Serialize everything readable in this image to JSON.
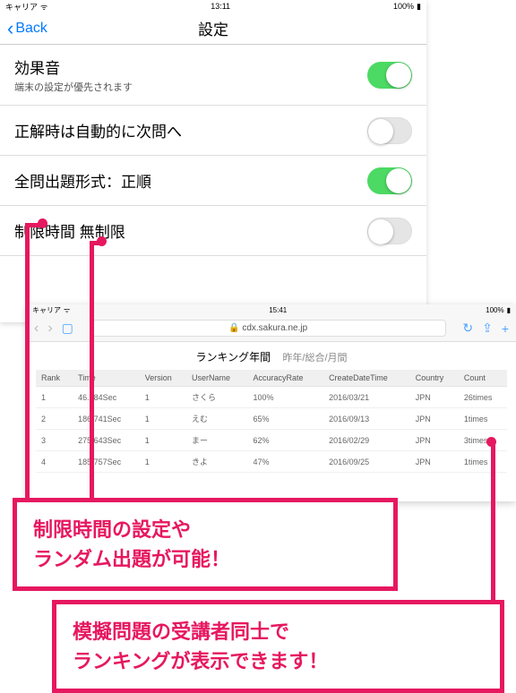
{
  "settings": {
    "status": {
      "carrier": "キャリア",
      "wifi": "ᯤ",
      "time": "13:11",
      "battery": "100%"
    },
    "back": "Back",
    "title": "設定",
    "rows": [
      {
        "title": "効果音",
        "sub": "端末の設定が優先されます",
        "on": true
      },
      {
        "title": "正解時は自動的に次問へ",
        "sub": "",
        "on": false
      },
      {
        "title": "全問出題形式：正順",
        "sub": "",
        "on": true
      },
      {
        "title": "制限時間 無制限",
        "sub": "",
        "on": false
      }
    ]
  },
  "browser": {
    "status": {
      "carrier": "キャリア",
      "wifi": "ᯤ",
      "time": "15:41",
      "battery": "100%"
    },
    "url_lock": "🔒",
    "url": "cdx.sakura.ne.jp",
    "title_main": "ランキング年間",
    "title_sub": "昨年/総合/月間",
    "headers": [
      "Rank",
      "Time",
      "Version",
      "UserName",
      "AccuracyRate",
      "CreateDateTime",
      "Country",
      "Count"
    ],
    "rows": [
      [
        "1",
        "46.384Sec",
        "1",
        "さくら",
        "100%",
        "2016/03/21",
        "JPN",
        "26times"
      ],
      [
        "2",
        "186.741Sec",
        "1",
        "えむ",
        "65%",
        "2016/09/13",
        "JPN",
        "1times"
      ],
      [
        "3",
        "275.643Sec",
        "1",
        "まー",
        "62%",
        "2016/02/29",
        "JPN",
        "3times"
      ],
      [
        "4",
        "185.757Sec",
        "1",
        "きよ",
        "47%",
        "2016/09/25",
        "JPN",
        "1times"
      ]
    ]
  },
  "callouts": {
    "c1_l1": "制限時間の設定や",
    "c1_l2": "ランダム出題が可能！",
    "c2_l1": "模擬問題の受講者同士で",
    "c2_l2": "ランキングが表示できます！"
  }
}
